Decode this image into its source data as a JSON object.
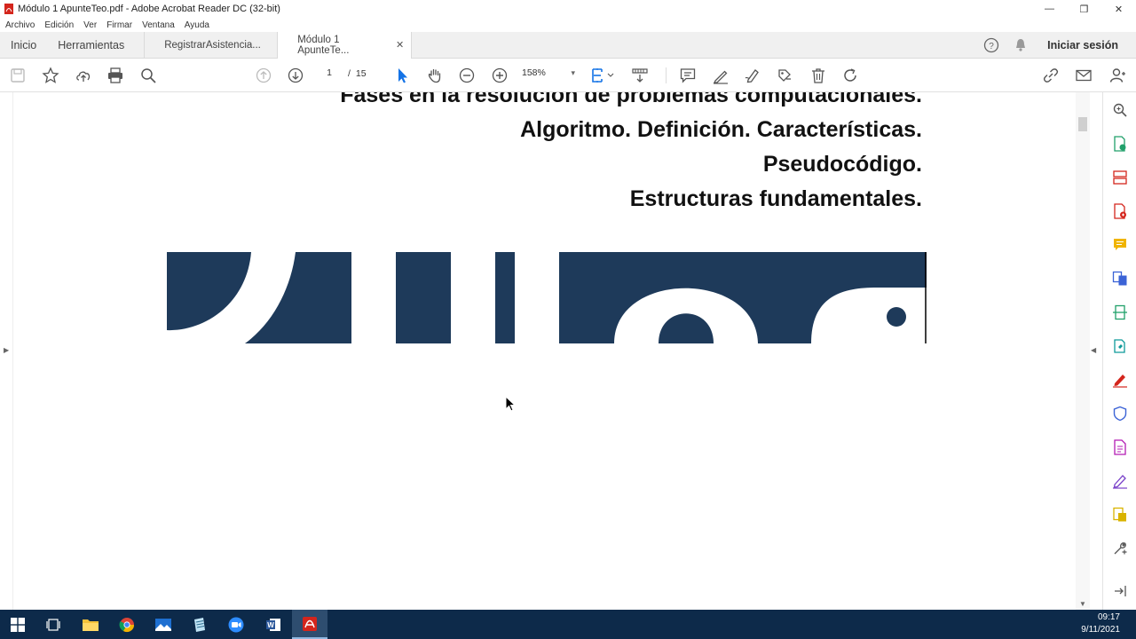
{
  "window": {
    "title": "Módulo 1 ApunteTeo.pdf - Adobe Acrobat Reader DC (32-bit)",
    "minimize_glyph": "—",
    "maximize_glyph": "❐",
    "close_glyph": "✕"
  },
  "menu": {
    "items": [
      "Archivo",
      "Edición",
      "Ver",
      "Firmar",
      "Ventana",
      "Ayuda"
    ]
  },
  "tabs": {
    "home": "Inicio",
    "tools": "Herramientas",
    "documents": [
      {
        "label": "RegistrarAsistencia...",
        "active": false
      },
      {
        "label": "Módulo 1 ApunteTe...",
        "active": true,
        "close_glyph": "✕"
      }
    ],
    "signin": "Iniciar sesión"
  },
  "toolbar": {
    "page_current": "1",
    "page_separator": "/",
    "page_total": "15",
    "zoom": "158%",
    "zoom_caret": "▾"
  },
  "document": {
    "headings": [
      "Fases en la resolución de problemas computacionales.",
      "Algoritmo. Definición. Características.",
      "Pseudocódigo.",
      "Estructuras fundamentales."
    ],
    "banner_color": "#1e3a5a"
  },
  "panel_glyphs": {
    "left_expand": "▶",
    "right_collapse": "◀",
    "scroll_down": "▼"
  },
  "taskbar": {
    "time": "09:17",
    "date": "9/11/2021"
  },
  "colors": {
    "accent": "#1473e6",
    "taskbar": "#0d2a4a",
    "acrobat_red": "#d4251c"
  }
}
